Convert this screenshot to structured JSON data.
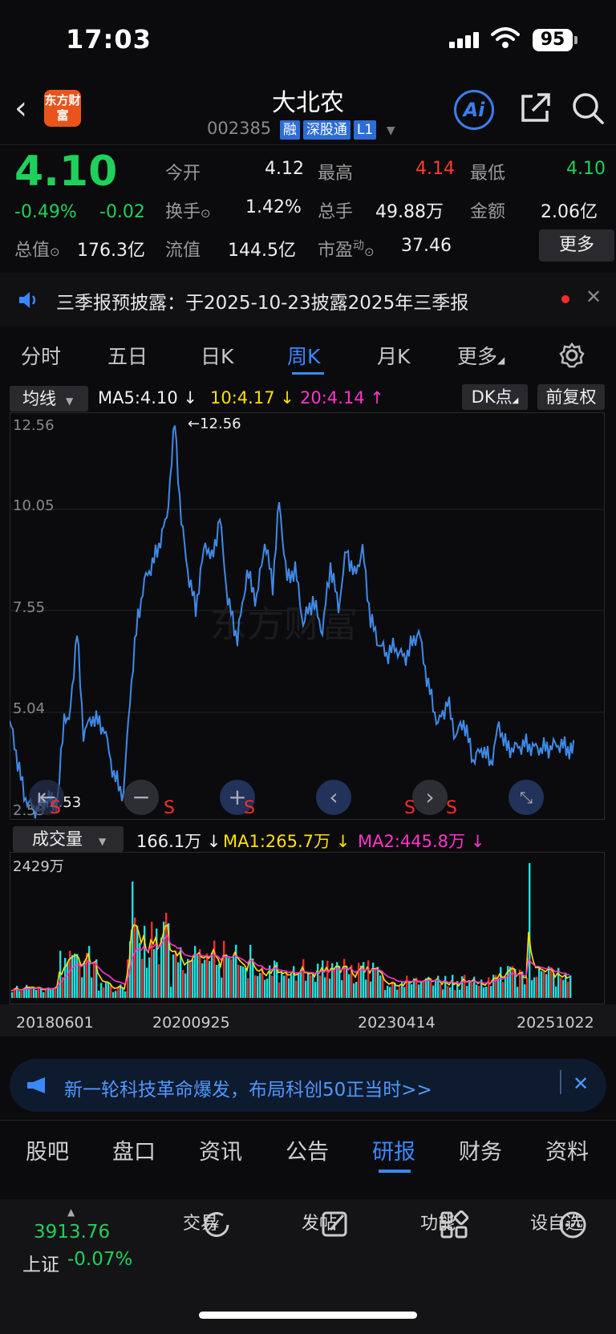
{
  "status": {
    "time": "17:03",
    "battery": "95"
  },
  "header": {
    "logo": "东方财富",
    "title": "大北农",
    "code": "002385",
    "tags": [
      "融",
      "深股通",
      "L1"
    ],
    "ai": "Ai"
  },
  "quote": {
    "price": "4.10",
    "change_pct": "-0.49%",
    "change": "-0.02",
    "open_label": "今开",
    "open": "4.12",
    "high_label": "最高",
    "high": "4.14",
    "low_label": "最低",
    "low": "4.10",
    "turnover_label": "换手",
    "turnover": "1.42%",
    "volume_label": "总手",
    "volume": "49.88万",
    "amount_label": "金额",
    "amount": "2.06亿",
    "mcap_label": "总值",
    "mcap": "176.3亿",
    "float_label": "流值",
    "float": "144.5亿",
    "pe_label": "市盈",
    "pe_sup": "动",
    "pe": "37.46",
    "more": "更多"
  },
  "notice": {
    "text": "三季报预披露：于2025-10-23披露2025年三季报"
  },
  "tabs": [
    "分时",
    "五日",
    "日K",
    "周K",
    "月K",
    "更多"
  ],
  "active_tab": "周K",
  "legend": {
    "mode": "均线",
    "ma5": "MA5:4.10",
    "ma10": "10:4.17",
    "ma20": "20:4.14",
    "dk": "DK点",
    "fq": "前复权"
  },
  "chart_data": {
    "type": "line",
    "y_ticks": [
      "12.56",
      "10.05",
      "7.55",
      "5.04",
      "2.53"
    ],
    "ylim": [
      2.53,
      12.56
    ],
    "max_label": "←12.56",
    "min_label": "←2.53",
    "x_ticks": [
      "20180601",
      "20200925",
      "20230414",
      "20251022"
    ],
    "colors": {
      "price": "#3f8ae8",
      "ma1": "#ffe000",
      "ma2": "#ff33cc",
      "up": "#ff2a2a",
      "down": "#1ee0e0"
    },
    "marks": [
      "S",
      "S",
      "S",
      "S",
      "S"
    ]
  },
  "volume": {
    "label": "成交量",
    "value": "166.1万",
    "ma1": "MA1:265.7万",
    "ma2": "MA2:445.8万",
    "max": "2429万"
  },
  "banner": {
    "text": "新一轮科技革命爆发，布局科创50正当时>>"
  },
  "footer_tabs": [
    "股吧",
    "盘口",
    "资讯",
    "公告",
    "研报",
    "财务",
    "资料"
  ],
  "footer_active": "研报",
  "bottom_nav": {
    "index_value": "3913.76",
    "index_name": "上证",
    "index_change": "-0.07%",
    "items": [
      "交易",
      "发帖",
      "功能",
      "设自选"
    ]
  }
}
